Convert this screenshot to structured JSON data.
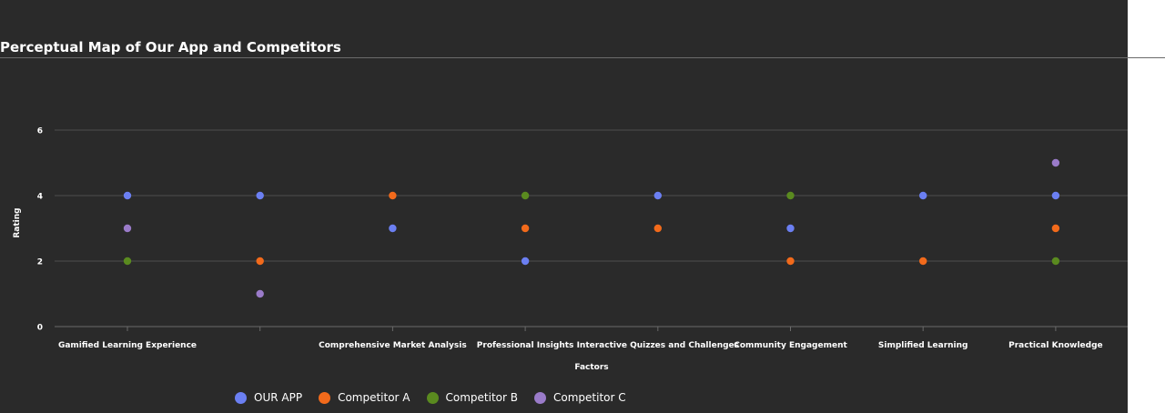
{
  "chart_data": {
    "type": "scatter",
    "title": "Perceptual Map of Our App and Competitors",
    "xlabel": "Factors",
    "ylabel": "Rating",
    "categories": [
      "Gamified Learning Experience",
      "",
      "Comprehensive Market Analysis",
      "Professional Insights",
      "Interactive Quizzes and Challenges",
      "Community Engagement",
      "Simplified Learning",
      "Practical Knowledge"
    ],
    "ylim": [
      0,
      7
    ],
    "yticks": [
      0,
      2,
      4,
      6
    ],
    "grid": true,
    "legend_position": "bottom",
    "series": [
      {
        "name": "OUR APP",
        "color": "#6b7ff2",
        "values": [
          4,
          4,
          3,
          2,
          4,
          3,
          4,
          4
        ]
      },
      {
        "name": "Competitor A",
        "color": "#f26a1b",
        "values": [
          null,
          2,
          4,
          3,
          3,
          2,
          2,
          3
        ]
      },
      {
        "name": "Competitor B",
        "color": "#5a8a1f",
        "values": [
          2,
          null,
          null,
          4,
          null,
          4,
          null,
          2
        ]
      },
      {
        "name": "Competitor C",
        "color": "#9a7bc9",
        "values": [
          3,
          1,
          null,
          null,
          null,
          null,
          null,
          5
        ]
      }
    ]
  }
}
